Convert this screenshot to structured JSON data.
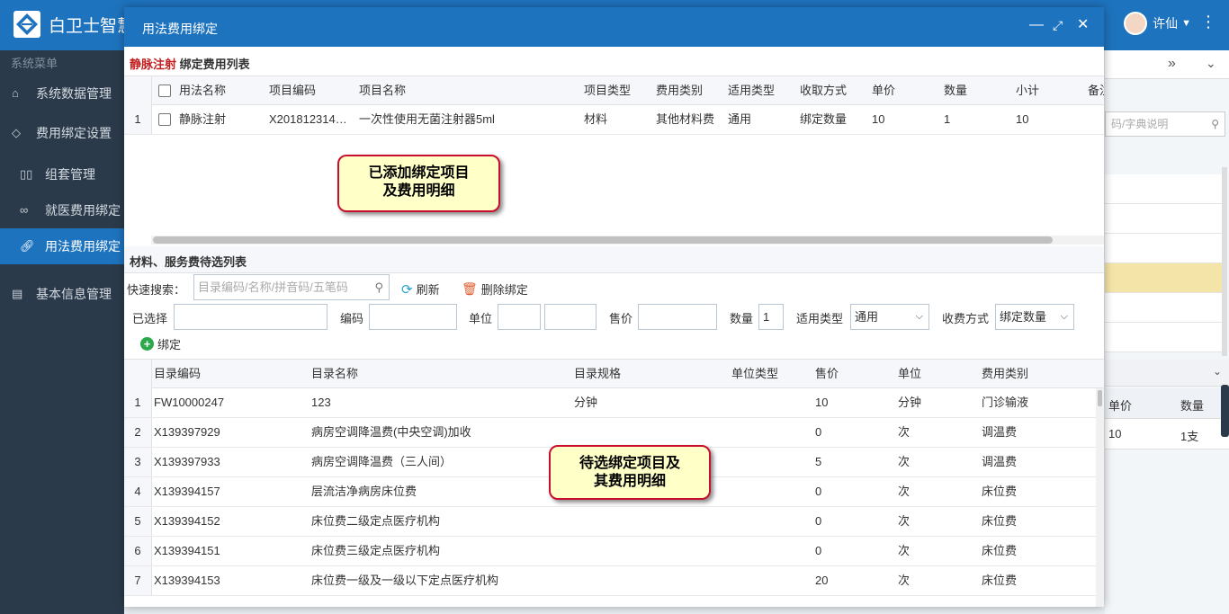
{
  "app": {
    "title": "白卫士智慧H",
    "user_name": "许仙"
  },
  "sidebar": {
    "header": "系统菜单",
    "items": [
      {
        "label": "系统数据管理"
      },
      {
        "label": "费用绑定设置"
      },
      {
        "label": "组套管理"
      },
      {
        "label": "就医费用绑定"
      },
      {
        "label": "用法费用绑定"
      },
      {
        "label": "基本信息管理"
      }
    ]
  },
  "background": {
    "search_placeholder": "码/字典说明",
    "table_headers": [
      "单价",
      "数量"
    ],
    "table_row": [
      "10",
      "1支"
    ]
  },
  "modal": {
    "title": "用法费用绑定",
    "section1": {
      "usage": "静脉注射",
      "title_suffix": "绑定费用列表",
      "headers": [
        "用法名称",
        "项目编码",
        "项目名称",
        "项目类型",
        "费用类别",
        "适用类型",
        "收取方式",
        "单价",
        "数量",
        "小计",
        "备注"
      ],
      "rows": [
        {
          "no": "1",
          "cells": [
            "静脉注射",
            "X201812314…",
            "一次性使用无菌注射器5ml",
            "材料",
            "其他材料费",
            "通用",
            "绑定数量",
            "10",
            "1",
            "10"
          ]
        }
      ]
    },
    "callout_top": [
      "已添加绑定项目",
      "及费用明细"
    ],
    "section2": {
      "title": "材料、服务费待选列表",
      "search_label": "快速搜索：",
      "search_placeholder": "目录编码/名称/拼音码/五笔码",
      "refresh": "刷新",
      "delete_binding": "删除绑定",
      "selected_label": "已选择",
      "code_label": "编码",
      "unit_label": "单位",
      "price_label": "售价",
      "qty_label": "数量",
      "qty_value": "1",
      "apply_type_label": "适用类型",
      "apply_type_value": "通用",
      "charge_mode_label": "收费方式",
      "charge_mode_value": "绑定数量",
      "bind": "绑定",
      "headers": [
        "目录编码",
        "目录名称",
        "目录规格",
        "单位类型",
        "售价",
        "单位",
        "费用类别"
      ],
      "rows": [
        {
          "no": "1",
          "cells": [
            "FW10000247",
            "123",
            "分钟",
            "",
            "10",
            "分钟",
            "门诊输液"
          ]
        },
        {
          "no": "2",
          "cells": [
            "X139397929",
            "病房空调降温费(中央空调)加收",
            "",
            "",
            "0",
            "次",
            "调温费"
          ]
        },
        {
          "no": "3",
          "cells": [
            "X139397933",
            "病房空调降温费（三人间）",
            "",
            "",
            "5",
            "次",
            "调温费"
          ]
        },
        {
          "no": "4",
          "cells": [
            "X139394157",
            "层流洁净病房床位费",
            "",
            "",
            "0",
            "次",
            "床位费"
          ]
        },
        {
          "no": "5",
          "cells": [
            "X139394152",
            "床位费二级定点医疗机构",
            "",
            "",
            "0",
            "次",
            "床位费"
          ]
        },
        {
          "no": "6",
          "cells": [
            "X139394151",
            "床位费三级定点医疗机构",
            "",
            "",
            "0",
            "次",
            "床位费"
          ]
        },
        {
          "no": "7",
          "cells": [
            "X139394153",
            "床位费一级及一级以下定点医疗机构",
            "",
            "",
            "20",
            "次",
            "床位费"
          ]
        }
      ]
    },
    "callout_bottom": [
      "待选绑定项目及",
      "其费用明细"
    ]
  }
}
